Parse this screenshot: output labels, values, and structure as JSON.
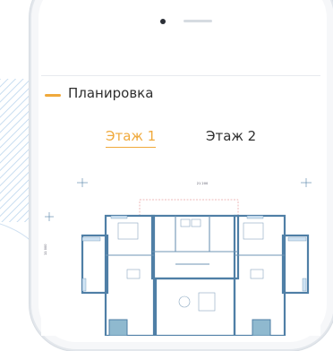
{
  "header": {
    "title": "Планировка"
  },
  "tabs": [
    {
      "label": "Этаж 1",
      "active": true
    },
    {
      "label": "Этаж 2",
      "active": false
    }
  ],
  "plan": {
    "top_dimension": "21 200",
    "side_dimension": "11 000"
  },
  "colors": {
    "accent": "#f0a93b",
    "wall": "#4f7fa6"
  }
}
